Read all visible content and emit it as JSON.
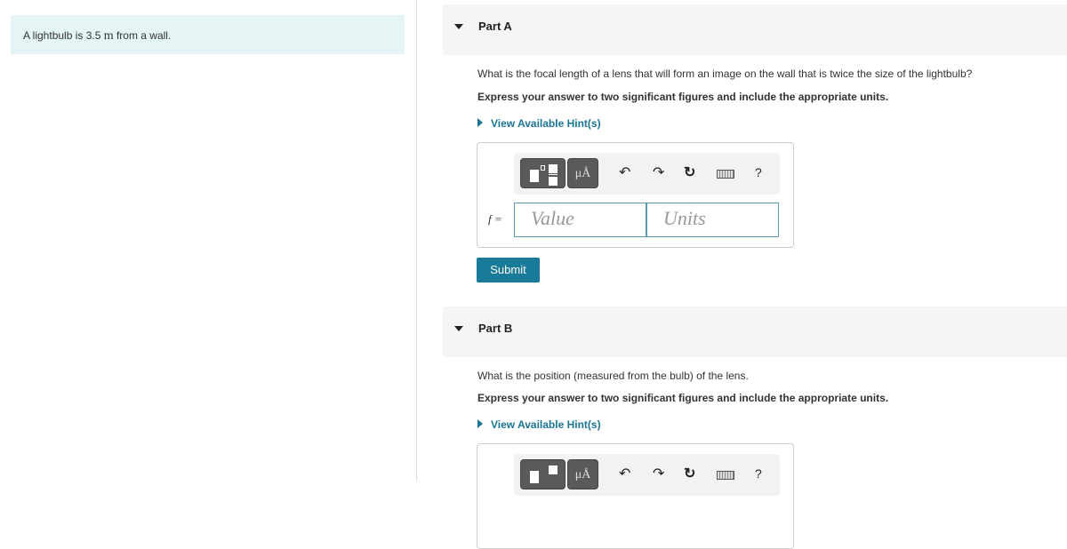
{
  "intro": {
    "text_before": "A lightbulb is 3.5 ",
    "unit": "m",
    "text_after": " from a wall."
  },
  "partA": {
    "label": "Part A",
    "question": "What is the focal length of a lens that will form an image on the wall that is twice the size of the lightbulb?",
    "express": "Express your answer to two significant figures and include the appropriate units.",
    "hint": "View Available Hint(s)",
    "var_label": "f =",
    "value_placeholder": "Value",
    "units_placeholder": "Units",
    "submit": "Submit"
  },
  "partB": {
    "label": "Part B",
    "question": "What is the position (measured from the bulb) of the lens.",
    "express": "Express your answer to two significant figures and include the appropriate units.",
    "hint": "View Available Hint(s)"
  },
  "toolbar": {
    "units_label": "μÅ",
    "undo": "↶",
    "redo": "↷",
    "reset": "↻",
    "help": "?"
  },
  "colors": {
    "accent": "#1a7a99",
    "intro_bg": "#e5f4f4"
  }
}
